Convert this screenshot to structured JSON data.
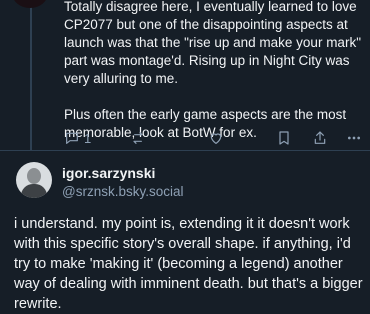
{
  "parent_post": {
    "text": "Totally disagree here, I eventually learned to love\nCP2077 but one of the disappointing aspects at\nlaunch was that the \"rise up and make your mark\"\npart was montage'd. Rising up in Night City was\nvery alluring to me.\n\nPlus often the early game aspects are the most\nmemorable, look at BotW for ex.",
    "actions": {
      "reply_count": "1",
      "repost_count": "",
      "like_count": ""
    }
  },
  "post": {
    "author_display_name": "igor.sarzynski",
    "author_handle": "@srznsk.bsky.social",
    "text": "i understand. my point is, extending it it doesn't work with this specific story's overall shape. if anything, i'd try to make 'making it' (becoming a legend) another way of dealing with imminent death. but that's a bigger rewrite."
  }
}
